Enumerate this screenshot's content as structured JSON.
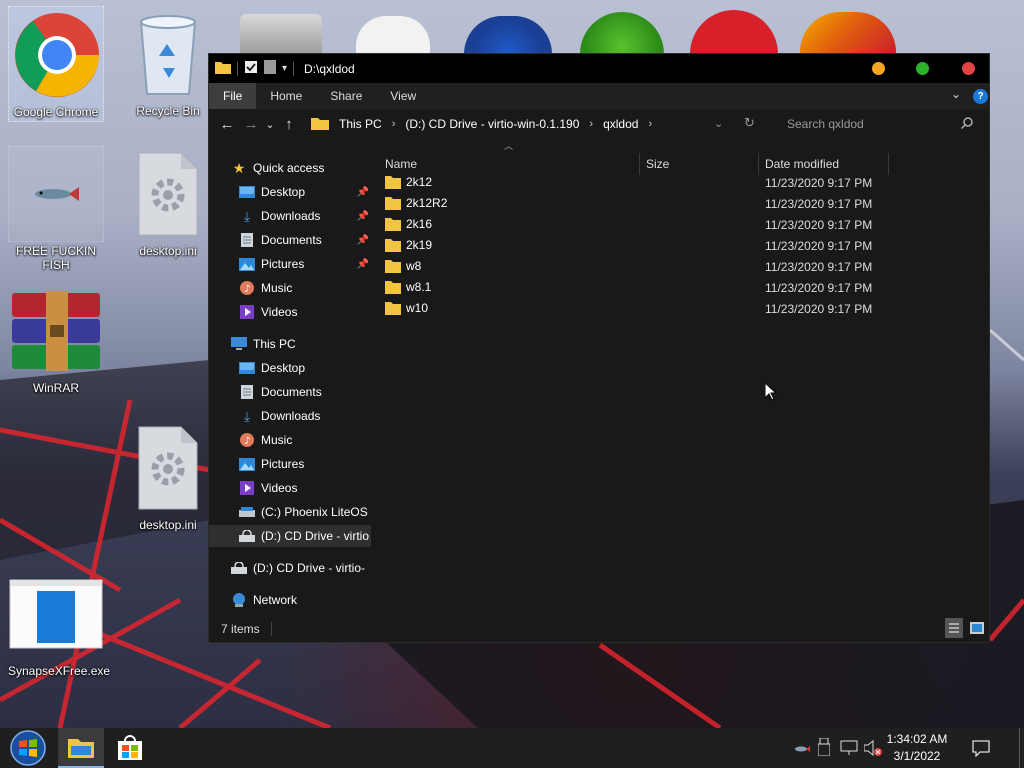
{
  "desktop": {
    "icons": [
      {
        "label": "Google Chrome"
      },
      {
        "label": "Recycle Bin"
      },
      {
        "label": "FREE FUCKIN FISH"
      },
      {
        "label": "desktop.ini"
      },
      {
        "label": "WinRAR"
      },
      {
        "label": "desktop.ini"
      },
      {
        "label": "SynapseXFree.exe"
      }
    ]
  },
  "window": {
    "title": "D:\\qxldod",
    "ribbon_tabs": [
      "File",
      "Home",
      "Share",
      "View"
    ],
    "address": {
      "segments": [
        "This PC",
        "(D:) CD Drive - virtio-win-0.1.190",
        "qxldod"
      ]
    },
    "search_placeholder": "Search qxldod",
    "columns": {
      "name": "Name",
      "size": "Size",
      "date": "Date modified"
    },
    "files": [
      {
        "name": "2k12",
        "date": "11/23/2020 9:17 PM"
      },
      {
        "name": "2k12R2",
        "date": "11/23/2020 9:17 PM"
      },
      {
        "name": "2k16",
        "date": "11/23/2020 9:17 PM"
      },
      {
        "name": "2k19",
        "date": "11/23/2020 9:17 PM"
      },
      {
        "name": "w8",
        "date": "11/23/2020 9:17 PM"
      },
      {
        "name": "w8.1",
        "date": "11/23/2020 9:17 PM"
      },
      {
        "name": "w10",
        "date": "11/23/2020 9:17 PM"
      }
    ],
    "sidebar": {
      "quick_access": "Quick access",
      "quick_items": [
        "Desktop",
        "Downloads",
        "Documents",
        "Pictures",
        "Music",
        "Videos"
      ],
      "this_pc": "This PC",
      "pc_items": [
        "Desktop",
        "Documents",
        "Downloads",
        "Music",
        "Pictures",
        "Videos",
        "(C:) Phoenix LiteOS",
        "(D:) CD Drive - virtio"
      ],
      "cd_drive": "(D:) CD Drive - virtio-",
      "network": "Network"
    },
    "status": "7 items",
    "colors": {
      "close": "#e04343",
      "minimize": "#f5a623",
      "maximize": "#2bb32b"
    }
  },
  "taskbar": {
    "time": "1:34:02 AM",
    "date": "3/1/2022"
  }
}
